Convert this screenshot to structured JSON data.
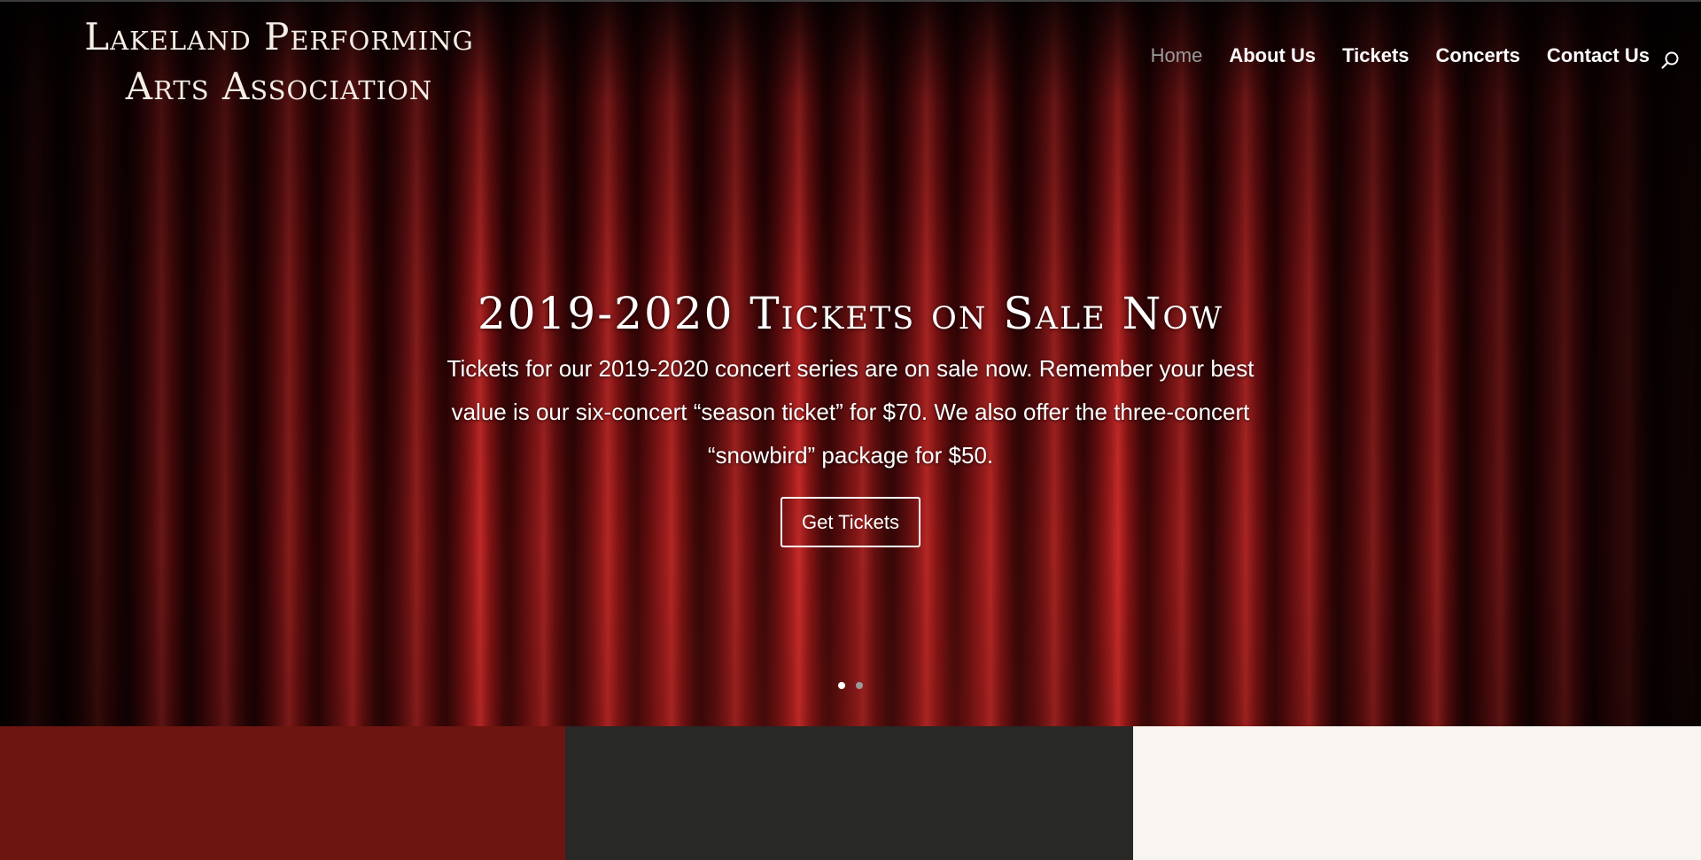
{
  "site": {
    "logo_line1": "Lakeland Performing",
    "logo_line2": "Arts Association"
  },
  "nav": {
    "items": [
      {
        "label": "Home",
        "active": true
      },
      {
        "label": "About Us",
        "active": false
      },
      {
        "label": "Tickets",
        "active": false
      },
      {
        "label": "Concerts",
        "active": false
      },
      {
        "label": "Contact Us",
        "active": false
      }
    ],
    "search_icon": "search-icon"
  },
  "hero": {
    "title": "2019-2020 Tickets on Sale Now",
    "text_line1": "Tickets for our 2019-2020 concert series are on sale now.  Remember your best",
    "text_line2": "value is our six-concert “season ticket” for $70. We also offer the three-concert",
    "text_line3": "“snowbird” package for $50.",
    "button_label": "Get Tickets",
    "slides": [
      {
        "active": true
      },
      {
        "active": false
      }
    ]
  },
  "colors": {
    "accent_red": "#6d1511",
    "dark_gray": "#282826",
    "cream": "#f8f4ef",
    "dot_active": "#ffffff",
    "dot_inactive": "#9a9a9a",
    "nav_active": "#9a9a9a"
  }
}
